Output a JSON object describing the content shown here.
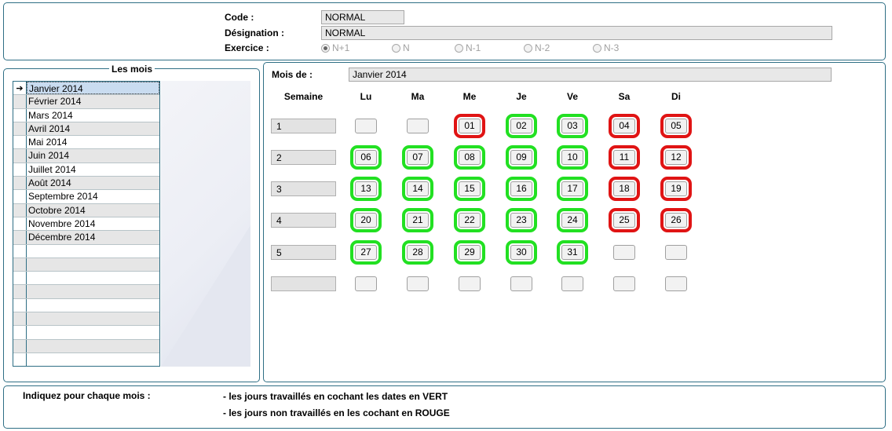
{
  "header": {
    "code_label": "Code :",
    "code_value": "NORMAL",
    "designation_label": "Désignation :",
    "designation_value": "NORMAL",
    "exercice_label": "Exercice :",
    "exercice_options": [
      {
        "label": "N+1",
        "selected": true
      },
      {
        "label": "N",
        "selected": false
      },
      {
        "label": "N-1",
        "selected": false
      },
      {
        "label": "N-2",
        "selected": false
      },
      {
        "label": "N-3",
        "selected": false
      }
    ]
  },
  "months_panel": {
    "title": "Les mois",
    "items": [
      "Janvier 2014",
      "Février 2014",
      "Mars 2014",
      "Avril 2014",
      "Mai 2014",
      "Juin 2014",
      "Juillet 2014",
      "Août 2014",
      "Septembre 2014",
      "Octobre 2014",
      "Novembre 2014",
      "Décembre 2014"
    ],
    "selected_index": 0,
    "empty_rows": 9
  },
  "calendar": {
    "month_label": "Mois de :",
    "month_value": "Janvier 2014",
    "week_header": "Semaine",
    "day_headers": [
      "Lu",
      "Ma",
      "Me",
      "Je",
      "Ve",
      "Sa",
      "Di"
    ],
    "weeks": [
      {
        "week": "1",
        "days": [
          {
            "n": "",
            "s": "none"
          },
          {
            "n": "",
            "s": "none"
          },
          {
            "n": "01",
            "s": "red"
          },
          {
            "n": "02",
            "s": "green"
          },
          {
            "n": "03",
            "s": "green"
          },
          {
            "n": "04",
            "s": "red"
          },
          {
            "n": "05",
            "s": "red"
          }
        ]
      },
      {
        "week": "2",
        "days": [
          {
            "n": "06",
            "s": "green"
          },
          {
            "n": "07",
            "s": "green"
          },
          {
            "n": "08",
            "s": "green"
          },
          {
            "n": "09",
            "s": "green"
          },
          {
            "n": "10",
            "s": "green"
          },
          {
            "n": "11",
            "s": "red"
          },
          {
            "n": "12",
            "s": "red"
          }
        ]
      },
      {
        "week": "3",
        "days": [
          {
            "n": "13",
            "s": "green"
          },
          {
            "n": "14",
            "s": "green"
          },
          {
            "n": "15",
            "s": "green"
          },
          {
            "n": "16",
            "s": "green"
          },
          {
            "n": "17",
            "s": "green"
          },
          {
            "n": "18",
            "s": "red"
          },
          {
            "n": "19",
            "s": "red"
          }
        ]
      },
      {
        "week": "4",
        "days": [
          {
            "n": "20",
            "s": "green"
          },
          {
            "n": "21",
            "s": "green"
          },
          {
            "n": "22",
            "s": "green"
          },
          {
            "n": "23",
            "s": "green"
          },
          {
            "n": "24",
            "s": "green"
          },
          {
            "n": "25",
            "s": "red"
          },
          {
            "n": "26",
            "s": "red"
          }
        ]
      },
      {
        "week": "5",
        "days": [
          {
            "n": "27",
            "s": "green"
          },
          {
            "n": "28",
            "s": "green"
          },
          {
            "n": "29",
            "s": "green"
          },
          {
            "n": "30",
            "s": "green"
          },
          {
            "n": "31",
            "s": "green"
          },
          {
            "n": "",
            "s": "none"
          },
          {
            "n": "",
            "s": "none"
          }
        ]
      },
      {
        "week": "",
        "days": [
          {
            "n": "",
            "s": "none"
          },
          {
            "n": "",
            "s": "none"
          },
          {
            "n": "",
            "s": "none"
          },
          {
            "n": "",
            "s": "none"
          },
          {
            "n": "",
            "s": "none"
          },
          {
            "n": "",
            "s": "none"
          },
          {
            "n": "",
            "s": "none"
          }
        ]
      }
    ],
    "colors": {
      "worked": "#22e022",
      "not_worked": "#e01414"
    }
  },
  "footer": {
    "intro": "Indiquez pour chaque mois :",
    "line1": "- les jours travaillés en cochant les dates en VERT",
    "line2": "- les jours non travaillés en les cochant en ROUGE"
  }
}
